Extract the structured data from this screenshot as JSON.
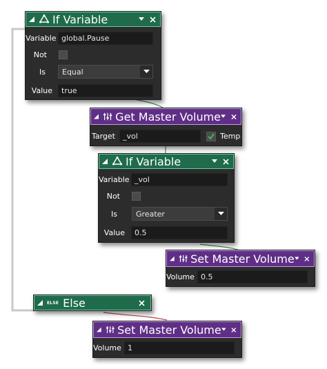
{
  "colors": {
    "green_header": "#1f6b4b",
    "purple_header": "#5f2e86",
    "body": "#2c2c2c",
    "field": "#1b1b1b"
  },
  "blocks": {
    "if1": {
      "title": "If Variable",
      "variable_label": "Variable",
      "variable_value": "global.Pause",
      "not_label": "Not",
      "is_label": "Is",
      "is_value": "Equal",
      "value_label": "Value",
      "value_value": "true"
    },
    "get_vol": {
      "title": "Get Master Volume",
      "target_label": "Target",
      "target_value": "_vol",
      "temp_label": "Temp",
      "temp_checked": true
    },
    "if2": {
      "title": "If Variable",
      "variable_label": "Variable",
      "variable_value": "_vol",
      "not_label": "Not",
      "is_label": "Is",
      "is_value": "Greater",
      "value_label": "Value",
      "value_value": "0.5"
    },
    "set_vol1": {
      "title": "Set Master Volume",
      "volume_label": "Volume",
      "volume_value": "0.5"
    },
    "else": {
      "tag": "ELSE",
      "title": "Else"
    },
    "set_vol2": {
      "title": "Set Master Volume",
      "volume_label": "Volume",
      "volume_value": "1"
    }
  },
  "icons": {
    "collapse": "collapse-triangle-icon",
    "if": "branch-icon",
    "volume": "sliders-icon",
    "menu": "chevron-down-icon",
    "close": "close-icon"
  }
}
